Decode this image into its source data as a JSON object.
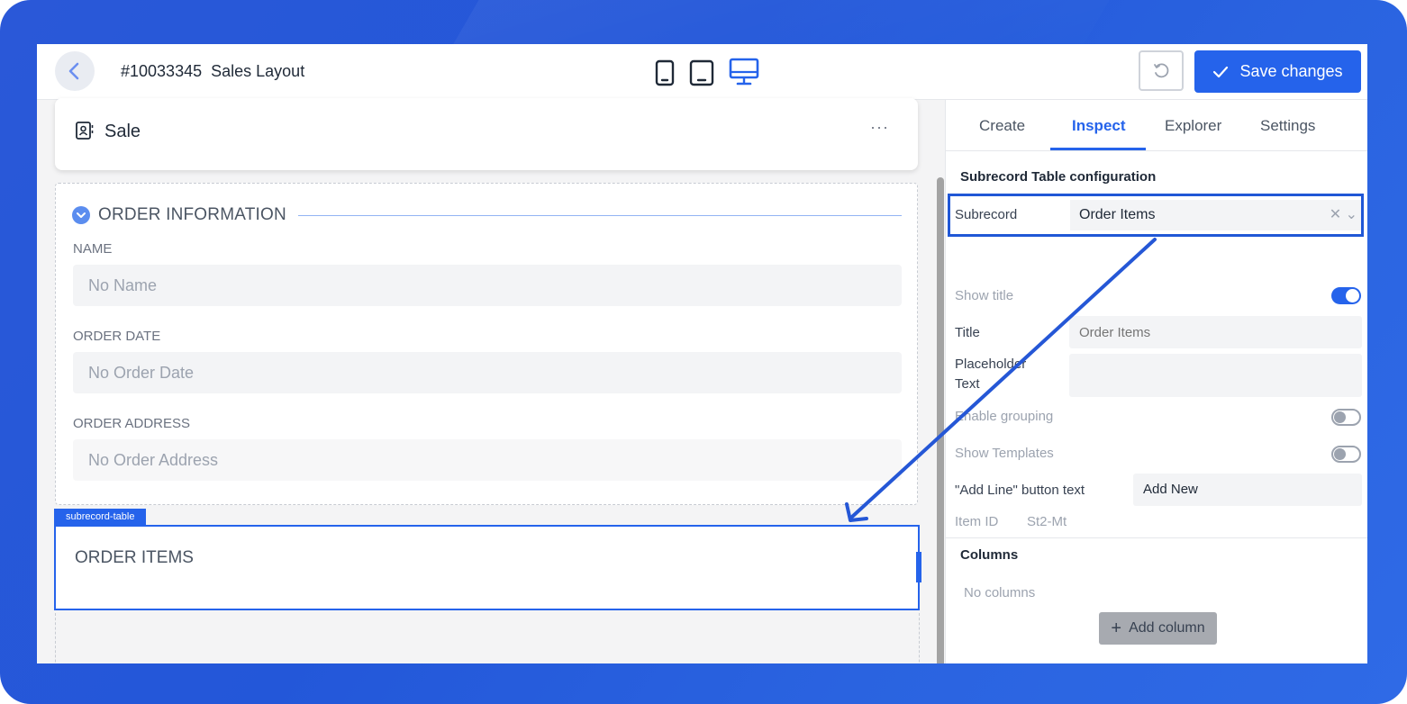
{
  "header": {
    "record_id": "#10033345",
    "layout_name": "Sales Layout",
    "save_label": "Save changes"
  },
  "canvas": {
    "card_title": "Sale",
    "more_label": "···",
    "section_title": "ORDER INFORMATION",
    "fields": [
      {
        "label": "NAME",
        "placeholder": "No Name"
      },
      {
        "label": "ORDER DATE",
        "placeholder": "No Order Date"
      },
      {
        "label": "ORDER ADDRESS",
        "placeholder": "No Order Address"
      }
    ],
    "selected_tag": "subrecord-table",
    "subtable_title": "ORDER ITEMS"
  },
  "panel": {
    "tabs": [
      "Create",
      "Inspect",
      "Explorer",
      "Settings"
    ],
    "active_tab": "Inspect",
    "config_title": "Subrecord Table configuration",
    "subrecord_label": "Subrecord",
    "subrecord_value": "Order Items",
    "show_title_label": "Show title",
    "show_title_on": true,
    "title_label": "Title",
    "title_placeholder": "Order Items",
    "placeholder_label_1": "Placeholder",
    "placeholder_label_2": "Text",
    "enable_grouping_label": "Enable grouping",
    "enable_grouping_on": false,
    "show_templates_label": "Show Templates",
    "show_templates_on": false,
    "add_line_label": "\"Add Line\" button text",
    "add_line_value": "Add New",
    "item_id_label": "Item ID",
    "item_id_value": "St2-Mt",
    "columns_title": "Columns",
    "no_columns": "No columns",
    "add_column_label": "Add column"
  },
  "colors": {
    "accent": "#2563eb",
    "frame": "#2357d9"
  }
}
